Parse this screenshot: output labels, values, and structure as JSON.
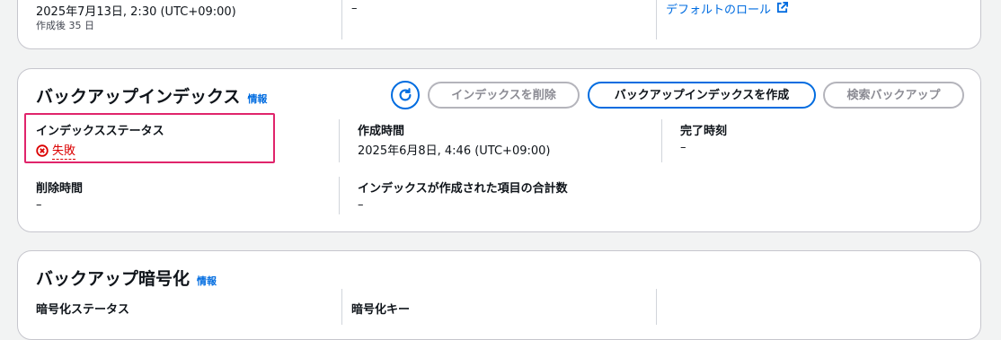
{
  "top_section": {
    "created_time": "2025年7月13日, 2:30 (UTC+09:00)",
    "created_after": "作成後 35 日",
    "middle_value": "–",
    "role_link": "デフォルトのロール"
  },
  "backup_index": {
    "title": "バックアップインデックス",
    "info_label": "情報",
    "buttons": {
      "delete_index": "インデックスを削除",
      "create_index": "バックアップインデックスを作成",
      "search_backup": "検索バックアップ"
    },
    "fields": {
      "index_status_label": "インデックスステータス",
      "index_status_value": "失敗",
      "created_time_label": "作成時間",
      "created_time_value": "2025年6月8日, 4:46 (UTC+09:00)",
      "completed_time_label": "完了時刻",
      "completed_time_value": "–",
      "deleted_time_label": "削除時間",
      "deleted_time_value": "–",
      "total_items_label": "インデックスが作成された項目の合計数",
      "total_items_value": "–"
    }
  },
  "backup_encryption": {
    "title": "バックアップ暗号化",
    "info_label": "情報",
    "encryption_status_label": "暗号化ステータス",
    "encryption_key_label": "暗号化キー"
  },
  "colors": {
    "accent": "#006ce0",
    "error": "#db0000",
    "highlight": "#e0246b"
  },
  "icons": [
    "external-link-icon",
    "refresh-icon",
    "error-circle-icon"
  ]
}
